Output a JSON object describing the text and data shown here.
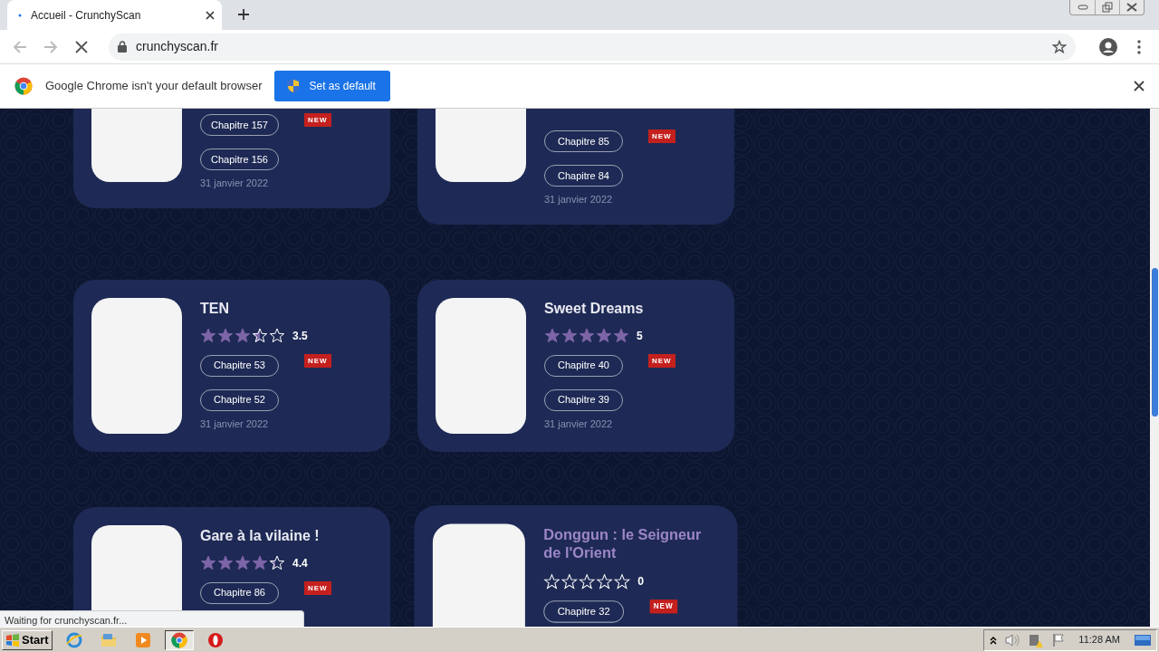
{
  "browser": {
    "tab_title": "Accueil - CrunchyScan",
    "address": "crunchyscan.fr",
    "loading": true
  },
  "infobar": {
    "message": "Google Chrome isn't your default browser",
    "button": "Set as default"
  },
  "sections": [
    {
      "cut_top": true,
      "cards": [
        {
          "chapters": [
            {
              "label": "Chapitre 157",
              "badge": "NEW"
            },
            {
              "label": "Chapitre 156"
            }
          ],
          "date": "31 janvier 2022",
          "hovered": false
        },
        {
          "chapters": [
            {
              "label": "Chapitre 85",
              "badge": "NEW"
            },
            {
              "label": "Chapitre 84"
            }
          ],
          "date": "31 janvier 2022",
          "hovered": false
        }
      ]
    },
    {
      "cut_top": false,
      "cards": [
        {
          "title": "TEN",
          "stars": 3.5,
          "rating": "3.5",
          "chapters": [
            {
              "label": "Chapitre 53",
              "badge": "NEW"
            },
            {
              "label": "Chapitre 52"
            }
          ],
          "date": "31 janvier 2022",
          "hovered": false
        },
        {
          "title": "Sweet Dreams",
          "stars": 5,
          "rating": "5",
          "chapters": [
            {
              "label": "Chapitre 40",
              "badge": "NEW"
            },
            {
              "label": "Chapitre 39"
            }
          ],
          "date": "31 janvier 2022",
          "hovered": false
        }
      ]
    },
    {
      "cut_top": false,
      "cards": [
        {
          "title": "Gare à la vilaine !",
          "stars": 4.4,
          "rating": "4.4",
          "chapters": [
            {
              "label": "Chapitre 86",
              "badge": "NEW"
            }
          ],
          "hovered": false
        },
        {
          "title": "Donggun : le Seigneur de l'Orient",
          "stars": 0,
          "rating": "0",
          "chapters": [
            {
              "label": "Chapitre 32",
              "badge": "NEW"
            }
          ],
          "hovered": true
        }
      ]
    }
  ],
  "status_bubble": "Waiting for crunchyscan.fr...",
  "taskbar": {
    "start": "Start",
    "clock": "11:28 AM"
  }
}
